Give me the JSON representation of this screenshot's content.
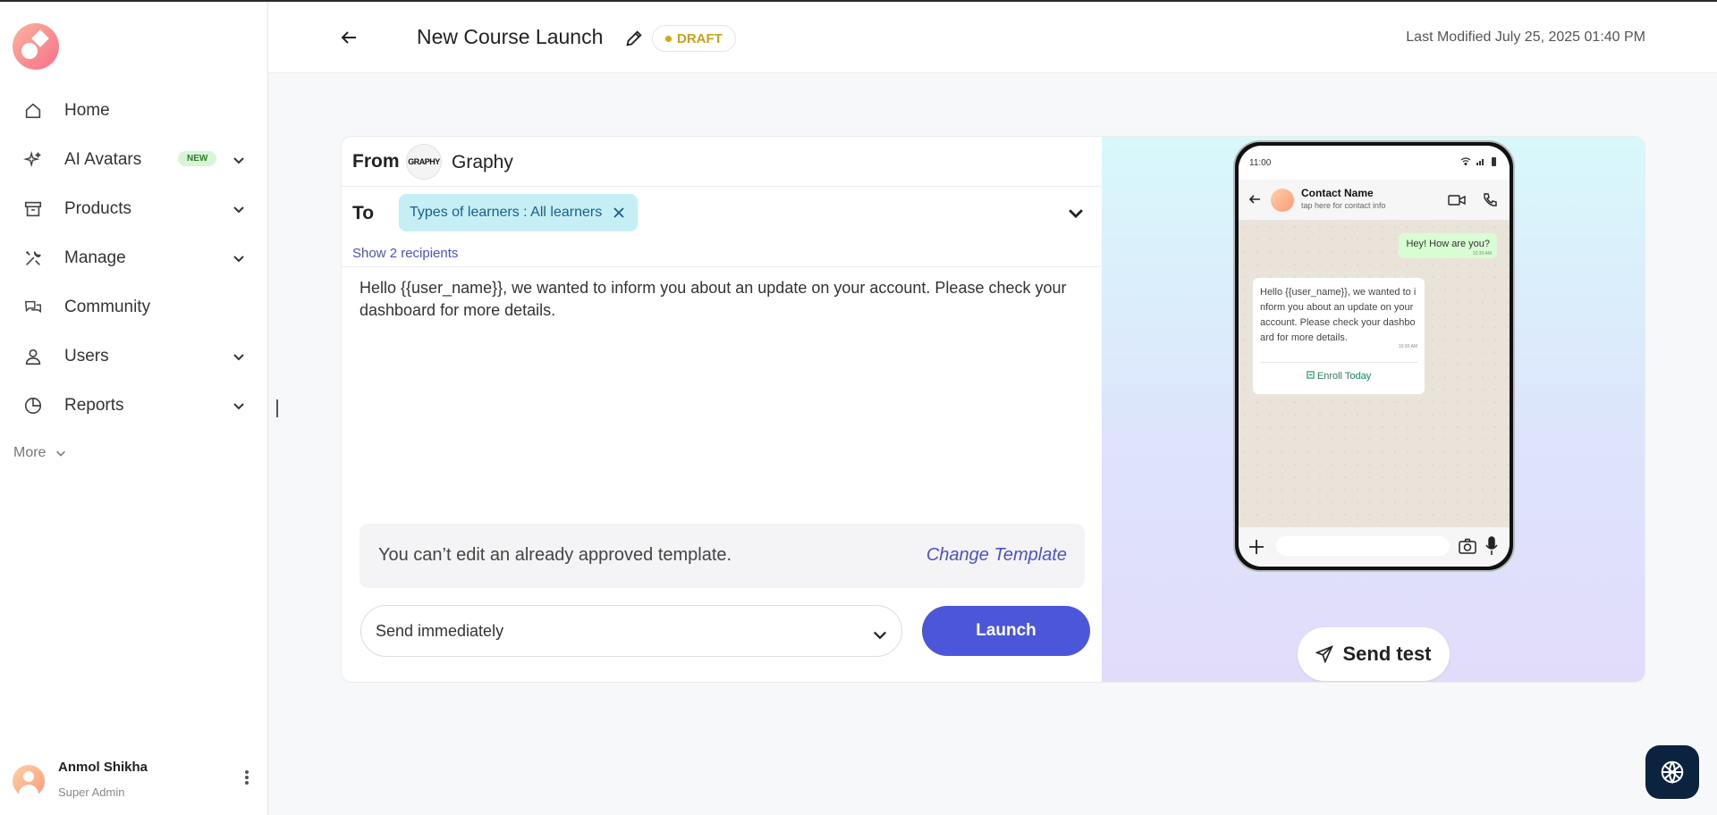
{
  "sidebar": {
    "items": [
      {
        "label": "Home",
        "icon": "home-icon"
      },
      {
        "label": "AI Avatars",
        "icon": "sparkles-icon",
        "badge": "NEW"
      },
      {
        "label": "Products",
        "icon": "archive-icon"
      },
      {
        "label": "Manage",
        "icon": "tools-icon"
      },
      {
        "label": "Community",
        "icon": "chat-bubbles-icon"
      },
      {
        "label": "Users",
        "icon": "user-icon"
      },
      {
        "label": "Reports",
        "icon": "pie-chart-icon"
      }
    ],
    "more_label": "More",
    "user": {
      "name": "Anmol Shikha",
      "role": "Super Admin"
    }
  },
  "header": {
    "title": "New Course Launch",
    "status": "DRAFT",
    "last_modified": "Last Modified July 25, 2025 01:40 PM"
  },
  "composer": {
    "from_label": "From",
    "sender_logo_text": "GRAPHY",
    "sender_name": "Graphy",
    "to_label": "To",
    "recipient_chip": "Types of learners : All learners",
    "show_recipients": "Show 2 recipients",
    "message": "Hello {{user_name}}, we wanted to inform you about an update on your account. Please check your dashboard for more details.",
    "notice_text": "You can’t edit an already approved template.",
    "change_template": "Change Template",
    "schedule_value": "Send immediately",
    "launch_label": "Launch"
  },
  "preview": {
    "status_time": "11:00",
    "contact_name": "Contact Name",
    "contact_sub": "tap here for contact info",
    "outgoing": "Hey! How are you?",
    "outgoing_time": "10:30 AM",
    "incoming": "Hello {{user_name}}, we wanted to inform you about an update on your account. Please check your dashboard for more details.",
    "incoming_time": "10:30 AM",
    "cta": "Enroll Today",
    "send_test": "Send test"
  },
  "colors": {
    "accent": "#4c56d9",
    "draft": "#c7a21c",
    "chip_bg": "#c6eef5"
  }
}
